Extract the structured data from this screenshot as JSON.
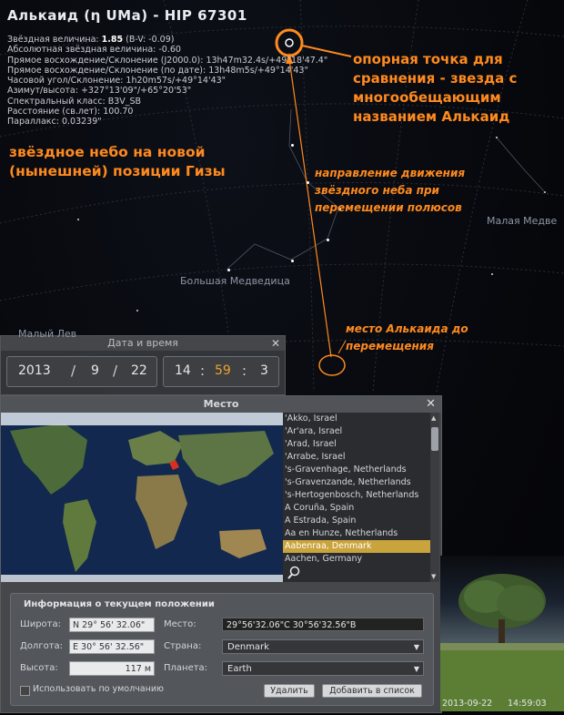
{
  "star": {
    "title": "Алькаид (η UMa) - HIP 67301",
    "info_lines": [
      {
        "label": "Звёздная величина: ",
        "bold": "1.85",
        "rest": " (B-V: -0.09)"
      },
      {
        "label": "Абсолютная звёздная величина: -0.60",
        "bold": "",
        "rest": ""
      },
      {
        "label": "Прямое восхождение/Склонение (J2000.0): 13h47m32.4s/+49°18'47.4\"",
        "bold": "",
        "rest": ""
      },
      {
        "label": "Прямое восхождение/Склонение (по дате): 13h48m5s/+49°14'43\"",
        "bold": "",
        "rest": ""
      },
      {
        "label": "Часовой угол/Склонение: 1h20m57s/+49°14'43\"",
        "bold": "",
        "rest": ""
      },
      {
        "label": "Азимут/высота: +327°13'09\"/+65°20'53\"",
        "bold": "",
        "rest": ""
      },
      {
        "label": "Спектральный класс: B3V_SB",
        "bold": "",
        "rest": ""
      },
      {
        "label": "Расстояние (св.лет): 100.70",
        "bold": "",
        "rest": ""
      },
      {
        "label": "Параллакс: 0.03239\"",
        "bold": "",
        "rest": ""
      }
    ]
  },
  "annotations": {
    "reference_star": "опорная точка для сравнения - звезда с многообещающим названием Алькаид",
    "sky_position": "звёздное небо на новой (нынешней) позиции Гизы",
    "motion_direction": "направление движения звёздного неба при перемещении полюсов",
    "former_position": "место Алькаида до перемещения",
    "color": "#ff8a1e"
  },
  "constellations": {
    "big_dipper": "Большая Медведица",
    "little_dipper": "Малая Медве",
    "leo_minor": "Малый Лев"
  },
  "date_window": {
    "title": "Дата и время",
    "year": "2013",
    "month": "9",
    "day": "22",
    "hour": "14",
    "minute": "59",
    "second": "3"
  },
  "location_window": {
    "title": "Место",
    "locations": [
      "'Akko, Israel",
      "'Ar'ara, Israel",
      "'Arad, Israel",
      "'Arrabe, Israel",
      "'s-Gravenhage, Netherlands",
      "'s-Gravenzande, Netherlands",
      "'s-Hertogenbosch, Netherlands",
      "A Coruña, Spain",
      "A Estrada, Spain",
      "Aa en Hunze, Netherlands",
      "Aabenraa, Denmark",
      "Aachen, Germany"
    ],
    "selected_index": 10,
    "panel": {
      "title": "Информация о текущем положении",
      "lat_label": "Широта:",
      "lat_value": "N 29° 56' 32.06\"",
      "lon_label": "Долгота:",
      "lon_value": "E 30° 56' 32.56\"",
      "alt_label": "Высота:",
      "alt_value": "117 м",
      "place_label": "Место:",
      "place_value": "29°56'32.06\"С  30°56'32.56\"В",
      "country_label": "Страна:",
      "country_value": "Denmark",
      "planet_label": "Планета:",
      "planet_value": "Earth",
      "default_label": "Использовать по умолчанию",
      "delete_label": "Удалить",
      "add_label": "Добавить в список"
    }
  },
  "status": {
    "date": "2013-09-22",
    "time": "14:59:03"
  }
}
